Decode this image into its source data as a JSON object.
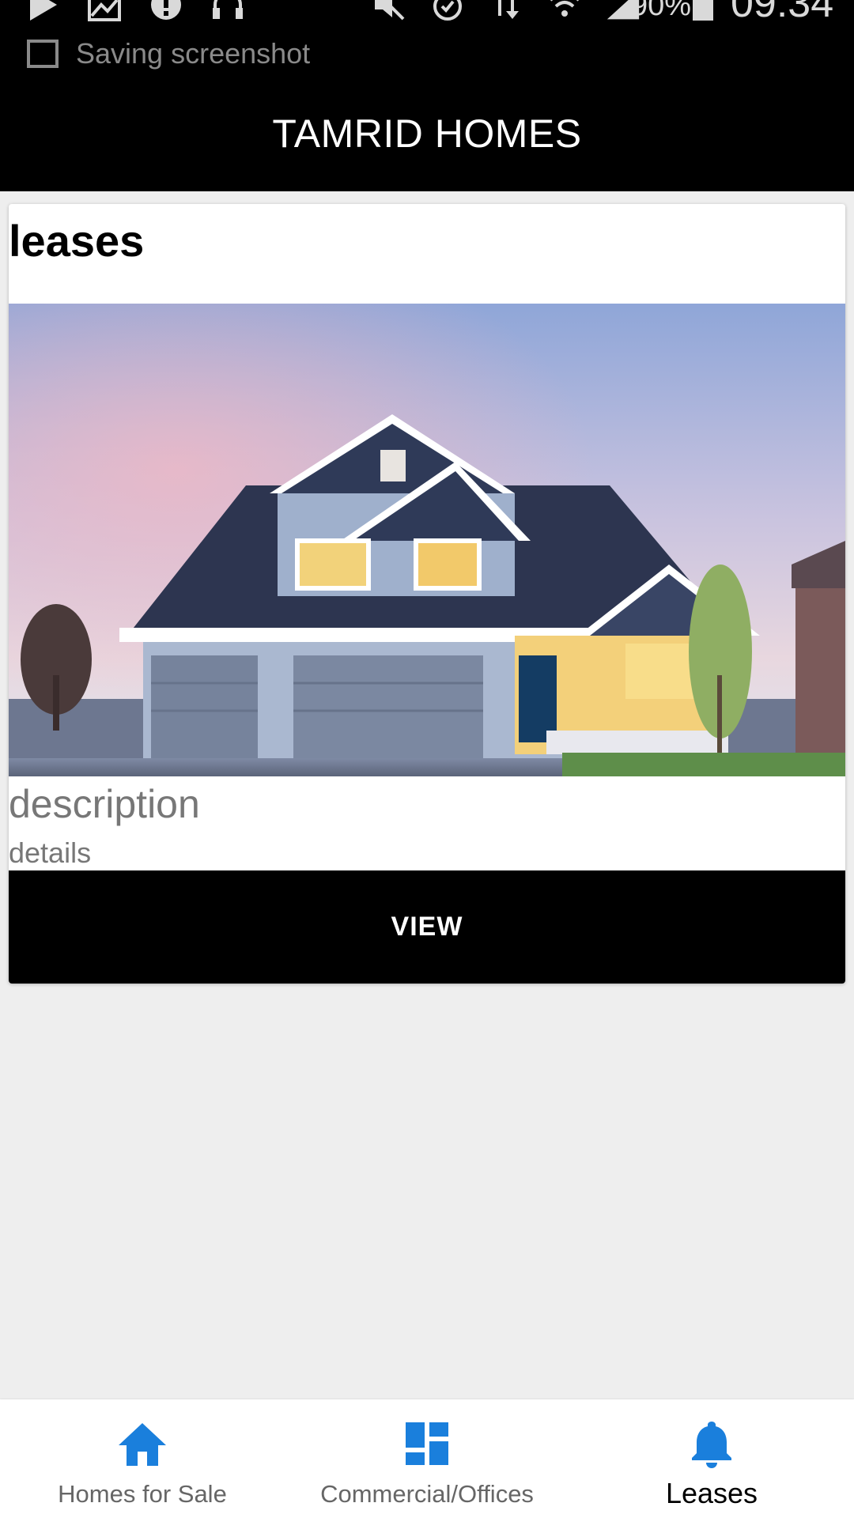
{
  "status_bar": {
    "battery_percent": "90%",
    "time": "09:34",
    "notification_text": "Saving screenshot",
    "left_icons": [
      "play-store-icon",
      "image-icon",
      "alert-icon",
      "headphones-icon"
    ],
    "right_icons": [
      "mute-icon",
      "alarm-icon",
      "data-transfer-icon",
      "wifi-icon",
      "signal-icon"
    ]
  },
  "app_bar": {
    "title": "TAMRID HOMES"
  },
  "card": {
    "heading": "leases",
    "image_alt": "house-photo",
    "description": "description",
    "details": "details",
    "view_label": "VIEW"
  },
  "bottom_nav": {
    "accent_color": "#1a7fdc",
    "items": [
      {
        "label": "Homes for Sale",
        "icon": "home-icon",
        "active": false
      },
      {
        "label": "Commercial/Offices",
        "icon": "dashboard-icon",
        "active": false
      },
      {
        "label": "Leases",
        "icon": "bell-icon",
        "active": true
      }
    ]
  }
}
